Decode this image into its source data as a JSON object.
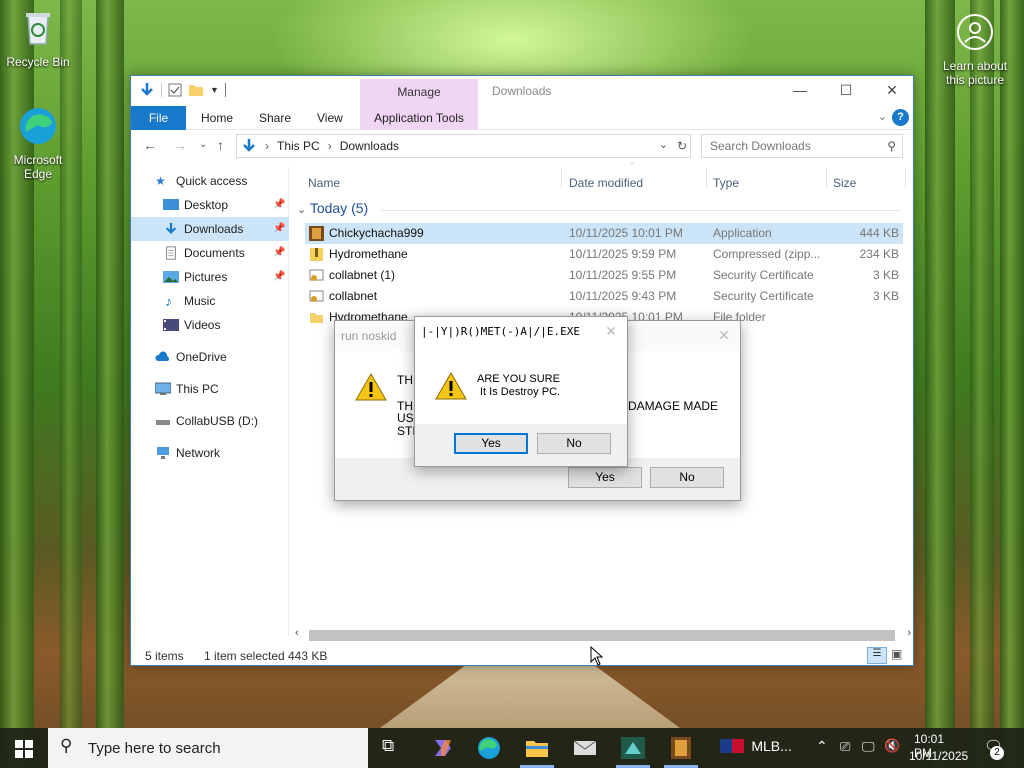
{
  "desktop": {
    "icons": [
      {
        "label": "Recycle Bin"
      },
      {
        "label": "Microsoft Edge"
      },
      {
        "label": "Learn about this picture"
      }
    ]
  },
  "explorer": {
    "title": "Downloads",
    "manage_tab": "Manage",
    "ribbon_tabs": [
      "File",
      "Home",
      "Share",
      "View",
      "Application Tools"
    ],
    "address": {
      "root": "This PC",
      "folder": "Downloads"
    },
    "search_placeholder": "Search Downloads",
    "nav": [
      {
        "label": "Quick access",
        "icon": "star-icon"
      },
      {
        "label": "Desktop",
        "icon": "desktop-icon",
        "pinned": true
      },
      {
        "label": "Downloads",
        "icon": "download-icon",
        "pinned": true,
        "selected": true
      },
      {
        "label": "Documents",
        "icon": "documents-icon",
        "pinned": true
      },
      {
        "label": "Pictures",
        "icon": "pictures-icon",
        "pinned": true
      },
      {
        "label": "Music",
        "icon": "music-icon"
      },
      {
        "label": "Videos",
        "icon": "videos-icon"
      },
      {
        "label": "OneDrive",
        "icon": "cloud-icon"
      },
      {
        "label": "This PC",
        "icon": "computer-icon"
      },
      {
        "label": "CollabUSB (D:)",
        "icon": "usb-drive-icon"
      },
      {
        "label": "Network",
        "icon": "network-icon"
      }
    ],
    "columns": [
      "Name",
      "Date modified",
      "Type",
      "Size"
    ],
    "group": "Today (5)",
    "files": [
      {
        "name": "Chickychacha999",
        "date": "10/11/2025 10:01 PM",
        "type": "Application",
        "size": "444 KB",
        "icon": "app-icon",
        "selected": true
      },
      {
        "name": "Hydromethane",
        "date": "10/11/2025 9:59 PM",
        "type": "Compressed (zipp...",
        "size": "234 KB",
        "icon": "zip-icon"
      },
      {
        "name": "collabnet (1)",
        "date": "10/11/2025 9:55 PM",
        "type": "Security Certificate",
        "size": "3 KB",
        "icon": "certificate-icon"
      },
      {
        "name": "collabnet",
        "date": "10/11/2025 9:43 PM",
        "type": "Security Certificate",
        "size": "3 KB",
        "icon": "certificate-icon"
      },
      {
        "name": "Hydromethane",
        "date": "10/11/2025 10:01 PM",
        "type": "File folder",
        "size": "",
        "icon": "folder-icon"
      }
    ],
    "status": {
      "items": "5 items",
      "selection": "1 item selected",
      "selection_size": "443 KB"
    }
  },
  "dialog_back": {
    "title": "run noskid",
    "line1": "THI",
    "line2": "THE",
    "line2_end": "DAMAGE MADE",
    "line3": "USI",
    "line4": "STIL",
    "yes": "Yes",
    "no": "No"
  },
  "dialog_front": {
    "title": "|-|Y|)R()MET(-)A|/|E.EXE",
    "line1": "ARE YOU SURE",
    "line2": "It Is Destroy PC.",
    "yes": "Yes",
    "no": "No"
  },
  "taskbar": {
    "search_placeholder": "Type here to search",
    "mlb_label": "MLB...",
    "time": "10:01 PM",
    "date": "10/11/2025",
    "notification_count": "2"
  }
}
